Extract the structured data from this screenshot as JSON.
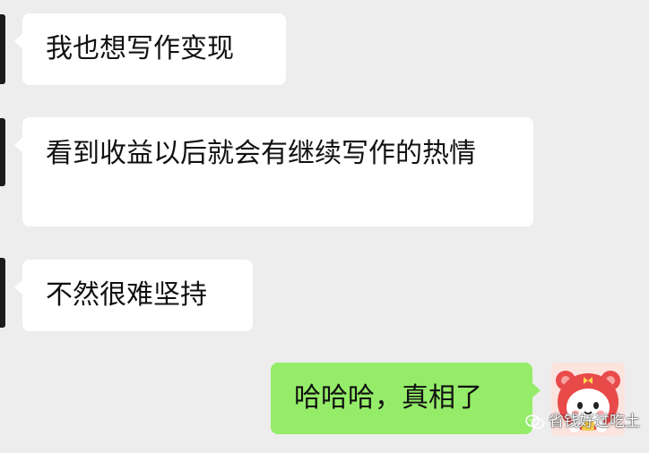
{
  "messages": [
    {
      "side": "left",
      "text": "我也想写作变现"
    },
    {
      "side": "left",
      "text": "看到收益以后就会有继续写作的热情"
    },
    {
      "side": "left",
      "text": "不然很难坚持"
    },
    {
      "side": "right",
      "text": "哈哈哈，真相了"
    }
  ],
  "watermark": {
    "text": "省钱好过吃土"
  },
  "colors": {
    "background": "#ededed",
    "incoming_bubble": "#ffffff",
    "outgoing_bubble": "#95ec69",
    "text": "#111111"
  },
  "icons": {
    "sender_avatar": "avatar-stub",
    "my_avatar": "pink-bear-sticker-avatar",
    "watermark_logo": "wechat-channel-icon"
  }
}
